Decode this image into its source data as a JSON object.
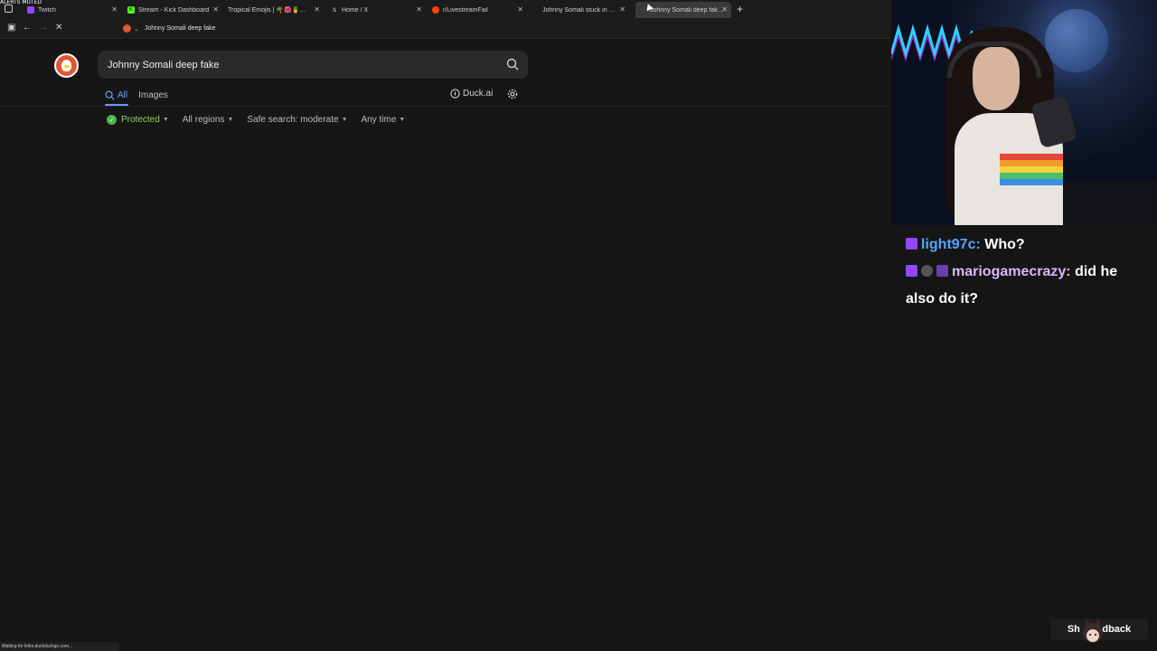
{
  "overlay": {
    "alerts_label": "ALERTS MUTED"
  },
  "browser": {
    "tabs": [
      {
        "title": "Twitch",
        "favicon": "twitch-icon",
        "color": "#9146ff",
        "active": false
      },
      {
        "title": "Stream - Kick Dashboard",
        "favicon": "kick-icon",
        "color": "#53fc18",
        "active": false
      },
      {
        "title": "Tropical Emojis | 🌴🌺🍍🐠🌊🍹",
        "favicon": "emoji-icon",
        "color": "#888888",
        "active": false
      },
      {
        "title": "Home / X",
        "favicon": "x-icon",
        "color": "#ffffff",
        "active": false
      },
      {
        "title": "r/LivestreamFail",
        "favicon": "reddit-icon",
        "color": "#ff4500",
        "active": false
      },
      {
        "title": "Johnny Somali stuck in jail \"hel",
        "favicon": "",
        "color": "#333333",
        "active": false
      },
      {
        "title": "Johnny Somali deep fake at D",
        "favicon": "loading-icon",
        "color": "#aaaaaa",
        "active": true
      }
    ],
    "address": "Johnny Somali deep fake",
    "status": "Waiting for links.duckduckgo.com..."
  },
  "search": {
    "query": "Johnny Somali deep fake",
    "tabs": {
      "all": "All",
      "images": "Images"
    },
    "duckai": "Duck.ai",
    "filters": {
      "protected": "Protected",
      "regions": "All regions",
      "safe": "Safe search: moderate",
      "time": "Any time"
    }
  },
  "chat": {
    "messages": [
      {
        "user": "light97c:",
        "text": "Who?"
      },
      {
        "user": "mariogamecrazy:",
        "text": "did he also do it?"
      }
    ],
    "badge_7tv": "7v"
  },
  "feedback": {
    "label": "Sh        dback"
  },
  "colors": {
    "accent": "#6b9cf5",
    "ddg": "#de5833",
    "protected": "#8fd65a"
  }
}
